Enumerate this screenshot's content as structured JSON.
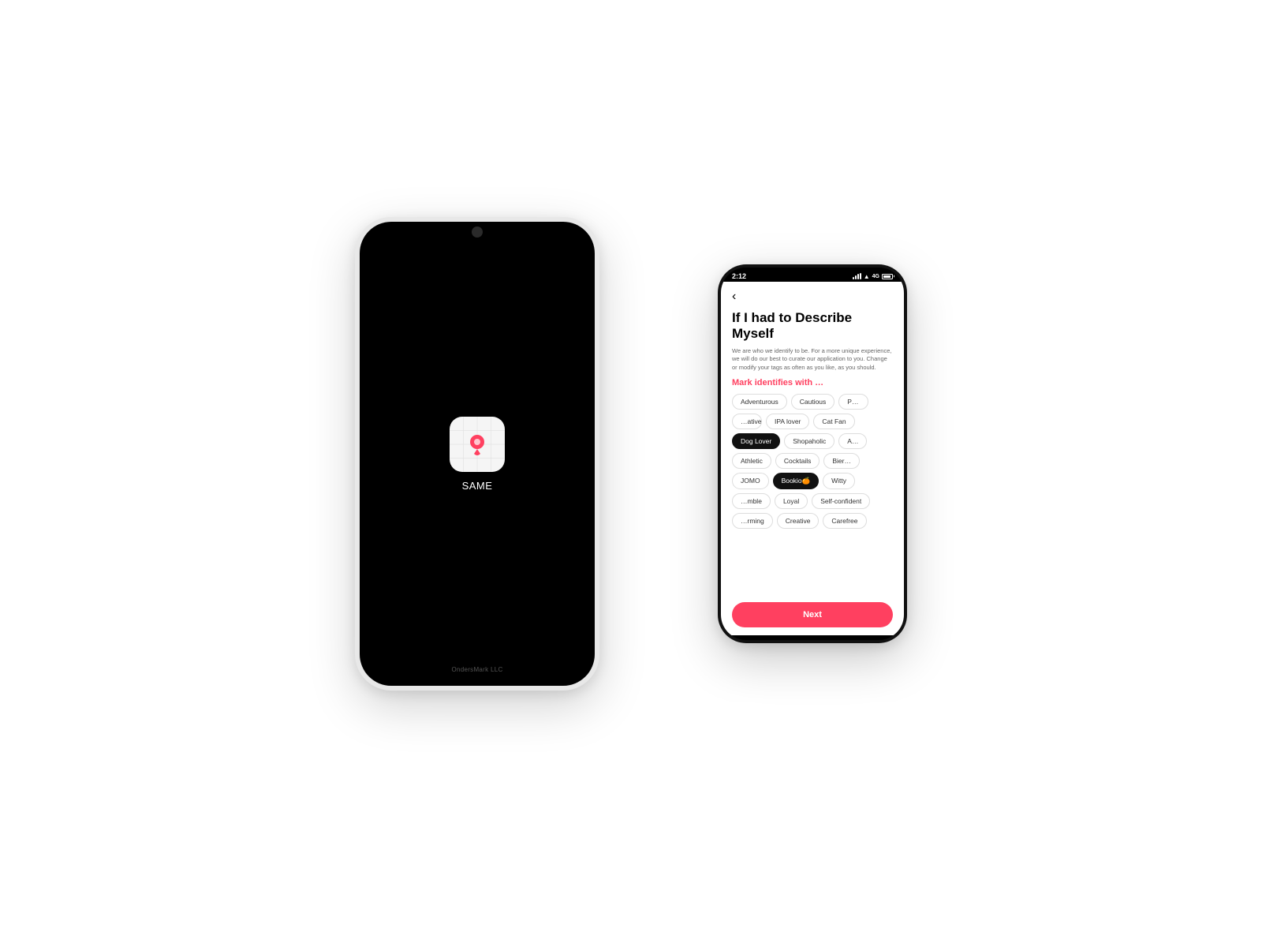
{
  "scene": {
    "big_phone": {
      "app_name": "SAME",
      "footer": "OndersMark LLC"
    },
    "small_phone": {
      "status_bar": {
        "time": "2:12",
        "battery_level": "85"
      },
      "screen": {
        "back_label": "‹",
        "title": "If I had to Describe Myself",
        "description": "We are who we identify to be. For a more unique experience, we will do our best to curate our application to you. Change or modify your tags as often as you like, as you should.",
        "section_label": "Mark identifies with …",
        "tags": [
          {
            "label": "Adventurous",
            "selected": false
          },
          {
            "label": "Cautious",
            "selected": false
          },
          {
            "label": "Pra…",
            "selected": false
          },
          {
            "label": "…native",
            "selected": false
          },
          {
            "label": "IPA lover",
            "selected": false
          },
          {
            "label": "Cat Fan",
            "selected": false
          },
          {
            "label": "Dog Lover",
            "selected": true,
            "style": "dark"
          },
          {
            "label": "Shopaholic",
            "selected": false
          },
          {
            "label": "A…",
            "selected": false
          },
          {
            "label": "Athletic",
            "selected": false
          },
          {
            "label": "Cocktails",
            "selected": false
          },
          {
            "label": "Bier…",
            "selected": false
          },
          {
            "label": "JOMO",
            "selected": false
          },
          {
            "label": "Bookio🍊",
            "selected": true,
            "style": "dark"
          },
          {
            "label": "Witty",
            "selected": false
          },
          {
            "label": "…mble",
            "selected": false
          },
          {
            "label": "Loyal",
            "selected": false
          },
          {
            "label": "Self-confident",
            "selected": false
          },
          {
            "label": "…rming",
            "selected": false
          },
          {
            "label": "Creative",
            "selected": false
          },
          {
            "label": "Carefree",
            "selected": false
          }
        ],
        "next_button": "Next"
      }
    }
  }
}
